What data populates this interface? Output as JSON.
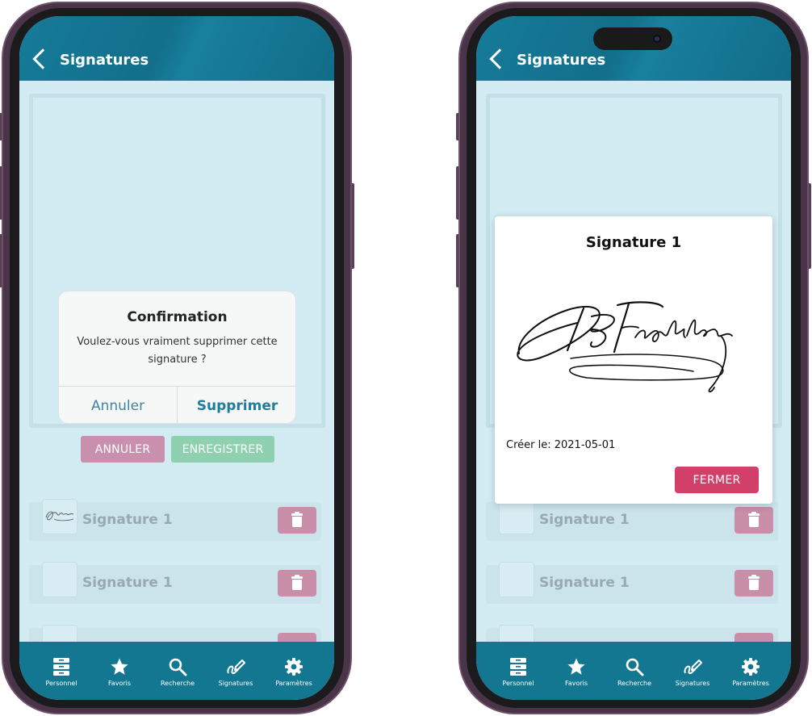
{
  "left_phone": {
    "header": {
      "title": "Signatures",
      "back_icon": "chevron-left-icon"
    },
    "actions": {
      "cancel_label": "ANNULER",
      "save_label": "ENREGISTRER"
    },
    "signatures": [
      {
        "name": "Signature 1"
      },
      {
        "name": "Signature 1"
      }
    ],
    "confirm_dialog": {
      "title": "Confirmation",
      "message": "Voulez-vous vraiment supprimer cette signature ?",
      "cancel_label": "Annuler",
      "delete_label": "Supprimer"
    },
    "nav": [
      {
        "label": "Personnel",
        "icon": "drawer-icon"
      },
      {
        "label": "Favoris",
        "icon": "star-icon"
      },
      {
        "label": "Recherche",
        "icon": "search-icon"
      },
      {
        "label": "Signatures",
        "icon": "signature-pen-icon"
      },
      {
        "label": "Paramètres",
        "icon": "gear-icon"
      }
    ]
  },
  "right_phone": {
    "header": {
      "title": "Signatures",
      "back_icon": "chevron-left-icon"
    },
    "signatures": [
      {
        "name": "Signature 1"
      },
      {
        "name": "Signature 1"
      }
    ],
    "view_modal": {
      "title": "Signature 1",
      "date_text": "Créer le: 2021-05-01",
      "close_label": "FERMER"
    },
    "nav": [
      {
        "label": "Personnel",
        "icon": "drawer-icon"
      },
      {
        "label": "Favoris",
        "icon": "star-icon"
      },
      {
        "label": "Recherche",
        "icon": "search-icon"
      },
      {
        "label": "Signatures",
        "icon": "signature-pen-icon"
      },
      {
        "label": "Paramètres",
        "icon": "gear-icon"
      }
    ]
  },
  "colors": {
    "header_bg": "#147791",
    "screen_bg": "#d3ebf2",
    "cancel_btn": "#c990ad",
    "save_btn": "#8fd0b0",
    "delete_btn": "#c98ea8",
    "close_btn": "#d23f69",
    "phone_frame": "#4a3548"
  }
}
